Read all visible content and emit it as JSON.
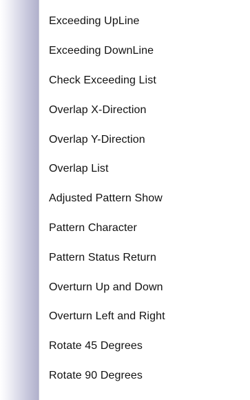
{
  "menu": {
    "items": [
      {
        "label": "Exceeding UpLine"
      },
      {
        "label": "Exceeding DownLine"
      },
      {
        "label": "Check Exceeding List"
      },
      {
        "label": "Overlap X-Direction"
      },
      {
        "label": "Overlap Y-Direction"
      },
      {
        "label": "Overlap List"
      },
      {
        "label": "Adjusted Pattern Show"
      },
      {
        "label": "Pattern Character"
      },
      {
        "label": "Pattern Status Return"
      },
      {
        "label": "Overturn Up and Down"
      },
      {
        "label": "Overturn Left and Right"
      },
      {
        "label": "Rotate 45 Degrees"
      },
      {
        "label": "Rotate 90 Degrees"
      }
    ]
  }
}
